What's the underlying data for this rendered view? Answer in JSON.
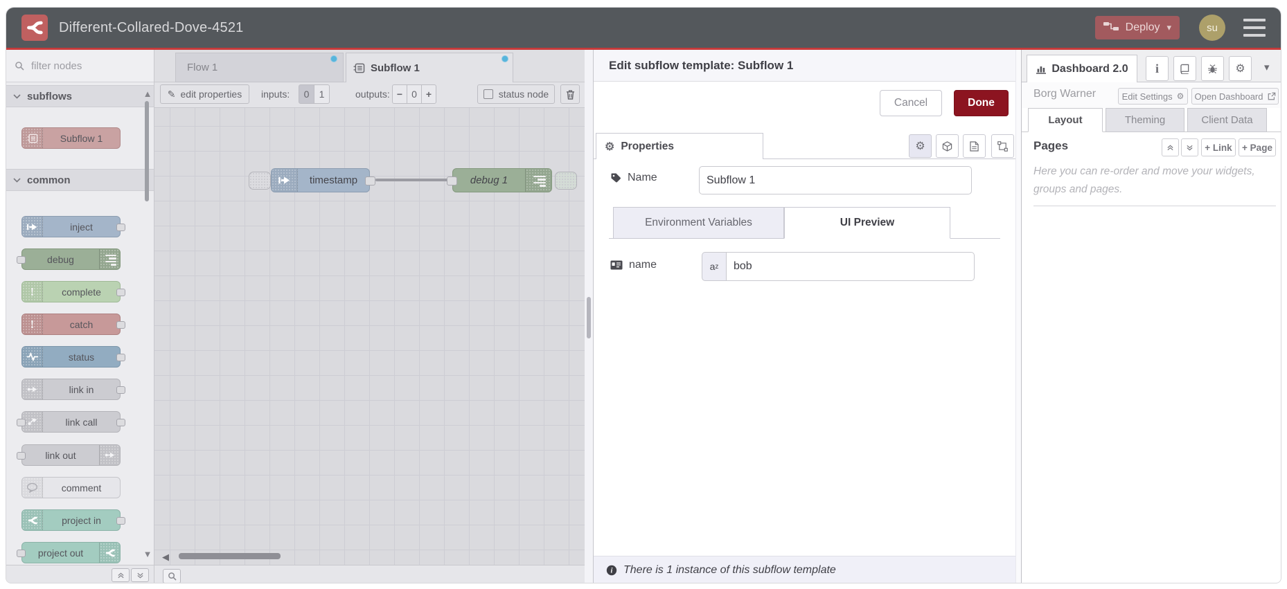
{
  "header": {
    "title": "Different-Collared-Dove-4521",
    "deploy_label": "Deploy",
    "user_initials": "su"
  },
  "palette": {
    "filter_placeholder": "filter nodes",
    "categories": [
      {
        "label": "subflows",
        "nodes": [
          {
            "label": "Subflow 1"
          }
        ]
      },
      {
        "label": "common",
        "nodes": [
          {
            "label": "inject"
          },
          {
            "label": "debug"
          },
          {
            "label": "complete"
          },
          {
            "label": "catch"
          },
          {
            "label": "status"
          },
          {
            "label": "link in"
          },
          {
            "label": "link call"
          },
          {
            "label": "link out"
          },
          {
            "label": "comment"
          },
          {
            "label": "project in"
          },
          {
            "label": "project out"
          }
        ]
      }
    ]
  },
  "workspace": {
    "tabs": [
      {
        "label": "Flow 1"
      },
      {
        "label": "Subflow 1"
      }
    ],
    "toolbar": {
      "edit_properties_label": "edit properties",
      "inputs_label": "inputs:",
      "input_zero": "0",
      "input_one": "1",
      "outputs_label": "outputs:",
      "minus": "−",
      "output_count": "0",
      "plus": "+",
      "status_node_label": "status node"
    },
    "nodes": [
      {
        "label": "timestamp"
      },
      {
        "label": "debug 1"
      }
    ]
  },
  "dialog": {
    "title": "Edit subflow template: Subflow 1",
    "cancel_label": "Cancel",
    "done_label": "Done",
    "properties_tab": "Properties",
    "name_label": "Name",
    "name_value": "Subflow 1",
    "env_tab_label": "Environment Variables",
    "ui_tab_label": "UI Preview",
    "env_row": {
      "label": "name",
      "type_main": "a",
      "type_sub": "z",
      "value": "bob"
    },
    "footer_text": "There is 1 instance of this subflow template"
  },
  "sidebar": {
    "active_tab": "Dashboard 2.0",
    "project_label": "Borg Warner",
    "edit_settings_label": "Edit Settings",
    "open_dashboard_label": "Open Dashboard",
    "tabs": [
      {
        "label": "Layout"
      },
      {
        "label": "Theming"
      },
      {
        "label": "Client Data"
      }
    ],
    "pages": {
      "title": "Pages",
      "link_label": "+ Link",
      "page_label": "+ Page",
      "help_text": "Here you can re-order and move your widgets, groups and pages."
    }
  },
  "colors": {
    "header_bg": "#54585C",
    "accent_red": "#C73B3B",
    "logo_bg": "#C06060",
    "deploy_bg": "#A25A5E",
    "avatar_bg": "#ADA06A",
    "done_bg": "#8C1420",
    "node_subflow": "#C9A2A2",
    "node_inject": "#A4B5C9",
    "node_debug": "#9BAF97",
    "node_complete": "#BAD2B2",
    "node_catch": "#C79999",
    "node_status": "#92ACC1",
    "node_project": "#A3CCC0",
    "tab_dot_blue": "#57B5DC"
  }
}
